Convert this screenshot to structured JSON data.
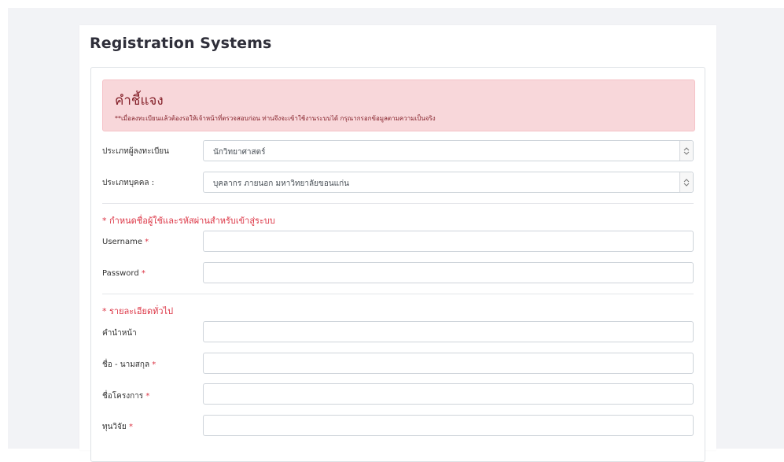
{
  "page": {
    "title": "Registration Systems"
  },
  "alert": {
    "heading": "คำชี้แจง",
    "text": "**เมื่อลงทะเบียนแล้วต้องรอให้เจ้าหน้าที่ตรวจสอบก่อน ท่านจึงจะเข้าใช้งานระบบได้ กรุณากรอกข้อมูลตามความเป็นจริง"
  },
  "registration_type": {
    "label": "ประเภทผู้ลงทะเบียน",
    "value": "นักวิทยาศาสตร์"
  },
  "person_type": {
    "label": "ประเภทบุคคล :",
    "value": "บุคลากร ภายนอก มหาวิทยาลัยขอนแก่น"
  },
  "account_section": {
    "heading": "* กำหนดชื่อผู้ใช้และรหัสผ่านสำหรับเข้าสู่ระบบ",
    "username_label": "Username",
    "password_label": "Password"
  },
  "general_section": {
    "heading": "* รายละเอียดทั่วไป",
    "prefix_label": "คำนำหน้า",
    "fullname_label": "ชื่อ - นามสกุล",
    "project_label": "ชื่อโครงการ",
    "grant_label": "ทุนวิจัย"
  },
  "required_mark": "*",
  "colors": {
    "alert_bg": "#f8d7da",
    "alert_text": "#842029",
    "required": "#dc3545",
    "page_bg": "#f2f3f6"
  },
  "icons": {
    "select_arrow": "chevron-updown-icon"
  }
}
